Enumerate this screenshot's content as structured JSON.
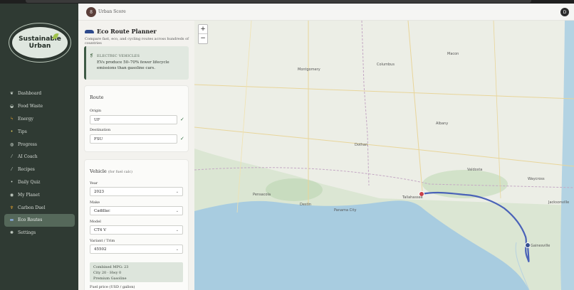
{
  "app": {
    "header_title": "Urban Score",
    "header_badge": "8",
    "user_initial": "D"
  },
  "logo": {
    "line1": "Sustainable",
    "line2": "Urban"
  },
  "sidebar": {
    "items": [
      {
        "label": "Dashboard",
        "icon": "leaf-icon"
      },
      {
        "label": "Food Waste",
        "icon": "bowl-icon"
      },
      {
        "label": "Energy",
        "icon": "bolt-icon"
      },
      {
        "label": "Tips",
        "icon": "bulb-icon"
      },
      {
        "label": "Progress",
        "icon": "globe-icon"
      },
      {
        "label": "AI Coach",
        "icon": "chat-icon"
      },
      {
        "label": "Recipes",
        "icon": "utensils-icon"
      },
      {
        "label": "Daily Quiz",
        "icon": "quiz-icon"
      },
      {
        "label": "My Planet",
        "icon": "planet-icon"
      },
      {
        "label": "Carbon Duel",
        "icon": "trophy-icon"
      },
      {
        "label": "Eco Routes",
        "icon": "car-icon",
        "active": true
      },
      {
        "label": "Settings",
        "icon": "gear-icon"
      }
    ]
  },
  "planner": {
    "title": "Eco Route Planner",
    "subtitle": "Compare fast, eco, and cycling routes across hundreds of countries",
    "ev_heading": "ELECTRIC VEHICLES",
    "ev_text": "EVs produce 50–70% fewer lifecycle emissions than gasoline cars.",
    "route_title": "Route",
    "origin_label": "Origin",
    "origin_value": "UF",
    "destination_label": "Destination",
    "destination_value": "FSU",
    "vehicle_title": "Vehicle",
    "vehicle_note": "(for fuel calc)",
    "year_label": "Year",
    "year_value": "2023",
    "make_label": "Make",
    "make_value": "Cadillac",
    "model_label": "Model",
    "model_value": "CT4 V",
    "variant_label": "Variant / Trim",
    "variant_value": "45502",
    "mpg_line1": "Combined MPG: 23",
    "mpg_line2": "City 20 · Hwy 0",
    "mpg_line3": "Premium Gasoline",
    "fuel_label": "Fuel price (USD / gallon)"
  },
  "map": {
    "zoom_in": "+",
    "zoom_out": "−",
    "labels": {
      "montgomery": "Montgomery",
      "columbus": "Columbus",
      "albany": "Albany",
      "dothan": "Dothan",
      "pensacola": "Pensacola",
      "panama_city": "Panama City",
      "jacksonville": "Jacksonville",
      "tallahassee": "Tallahassee",
      "valdosta": "Valdosta",
      "gainesville": "Gainesville",
      "macon": "Macon",
      "waycross": "Waycross",
      "destin": "Destin"
    },
    "route_color": "#4a62b8",
    "origin_marker_color": "#37508f",
    "destination_marker_color": "#c7414a"
  }
}
